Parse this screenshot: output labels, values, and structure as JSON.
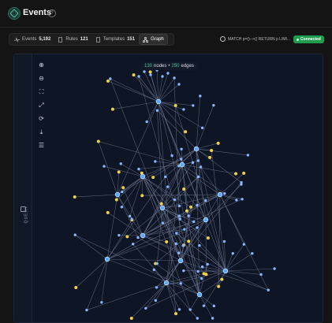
{
  "header": {
    "title": "Events"
  },
  "tabs": [
    {
      "label": "Events",
      "count": "5,192",
      "icon": "pulse-icon",
      "active": false
    },
    {
      "label": "Rules",
      "count": "121",
      "icon": "file-icon",
      "active": false
    },
    {
      "label": "Templates",
      "count": "151",
      "icon": "file-icon",
      "active": false
    },
    {
      "label": "Graph",
      "count": "",
      "icon": "graph-icon",
      "active": true
    }
  ],
  "query": {
    "text": "MATCH p=()-->() RETURN p LIMI..."
  },
  "status": {
    "label": "Connected",
    "color": "#1f9d4f"
  },
  "rail": {
    "label": "QUERY"
  },
  "graph": {
    "node_count": "130",
    "nodes_label": "nodes",
    "separator": "•",
    "edge_count": "250",
    "edges_label": "edges",
    "node_colors": {
      "hub": "#5aa8ff",
      "yellow": "#f2d14a",
      "blue": "#8ab6ff"
    },
    "edge_color": "#6b7690"
  },
  "toolbar": [
    "zoom-in-icon",
    "zoom-out-icon",
    "fit-screen-icon",
    "expand-icon",
    "refresh-icon",
    "download-icon",
    "settings-sliders-icon"
  ]
}
